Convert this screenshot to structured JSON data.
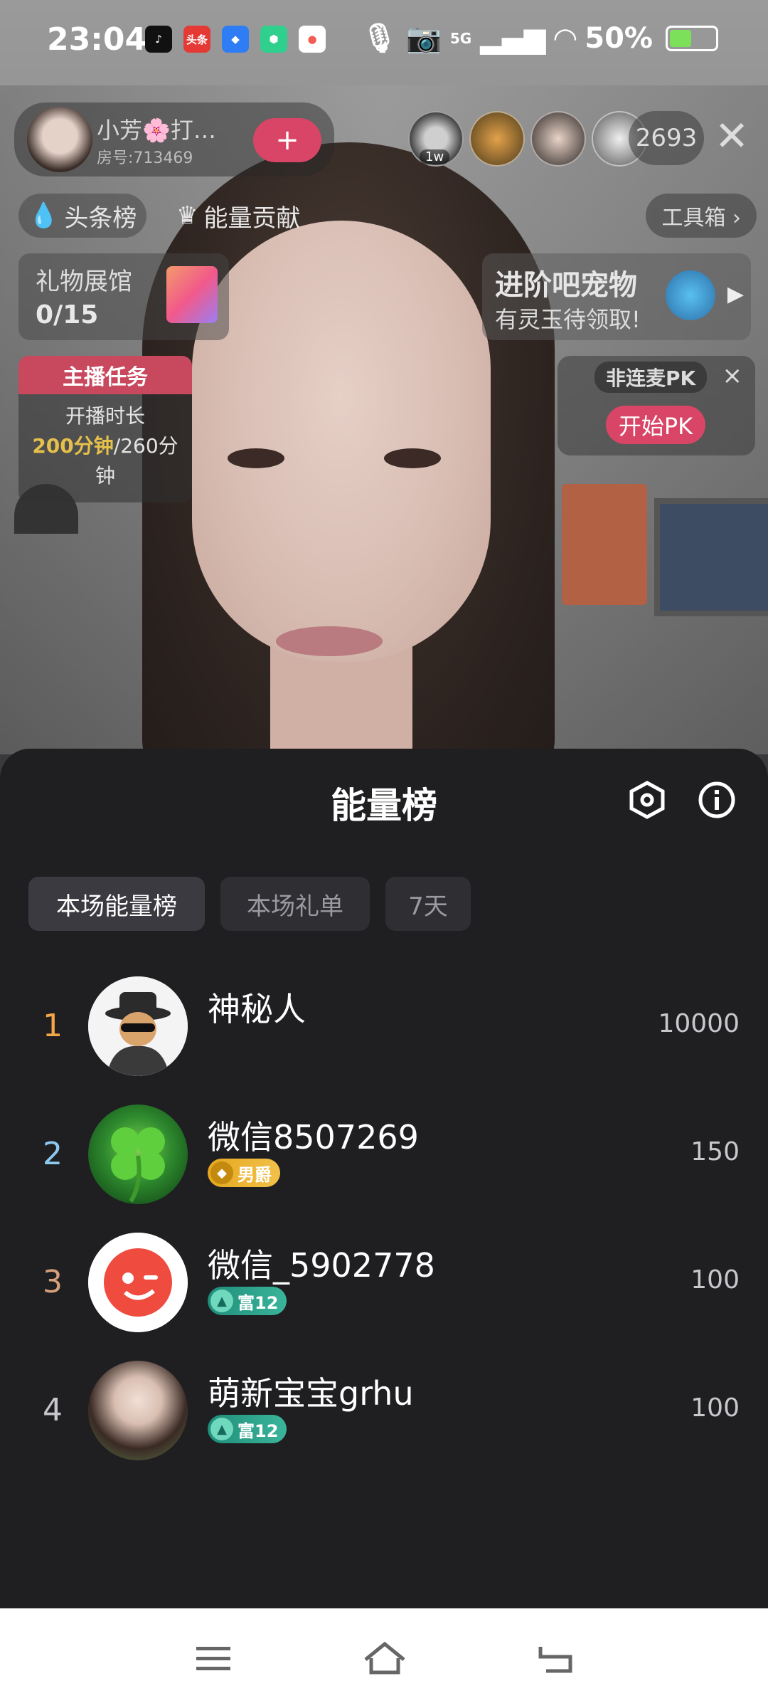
{
  "status_bar": {
    "time": "23:04",
    "app_icons": [
      {
        "icon": "douyin-icon",
        "label": "",
        "color": "#111111"
      },
      {
        "icon": "toutiao-icon",
        "label": "头条",
        "color": "#e53935"
      },
      {
        "icon": "app-icon",
        "label": "",
        "color": "#2f7df5"
      },
      {
        "icon": "cube-app-icon",
        "label": "",
        "color": "#2fcf8d"
      },
      {
        "icon": "map-app-icon",
        "label": "",
        "color": "#f25c54"
      }
    ],
    "network": "5G",
    "battery": "50%"
  },
  "host": {
    "name": "小芳🌸打…",
    "room": "房号:713469",
    "follow_label": "+"
  },
  "viewers": {
    "top_badge": "1w",
    "count": "2693",
    "close_label": "✕"
  },
  "top_tabs": {
    "headline": "头条榜",
    "energy": "能量贡献",
    "toolbox": "工具箱 ›"
  },
  "gift_hall": {
    "title": "礼物展馆",
    "count": "0/15"
  },
  "pet_banner": {
    "title": "进阶吧宠物",
    "subtitle": "有灵玉待领取!"
  },
  "host_task": {
    "header": "主播任务",
    "label": "开播时长",
    "progress_done": "200分钟",
    "progress_total": "/260分钟"
  },
  "pk": {
    "tag": "非连麦PK",
    "close": "×",
    "button": "开始PK"
  },
  "sheet": {
    "title": "能量榜",
    "tabs": [
      "本场能量榜",
      "本场礼单",
      "7天"
    ],
    "active_tab": 0,
    "entries": [
      {
        "rank": "1",
        "name": "神秘人",
        "score": "10000",
        "rank_color": "#f5a646",
        "badge": null
      },
      {
        "rank": "2",
        "name": "微信8507269",
        "score": "150",
        "rank_color": "#8ecaf0",
        "badge": {
          "text": "男爵",
          "style": "gold"
        }
      },
      {
        "rank": "3",
        "name": "微信_5902778",
        "score": "100",
        "rank_color": "#d7a07a",
        "badge": {
          "text": "富12",
          "style": "teal"
        }
      },
      {
        "rank": "4",
        "name": "萌新宝宝grhu",
        "score": "100",
        "rank_color": "#c8c8cc",
        "badge": {
          "text": "富12",
          "style": "teal"
        }
      }
    ]
  },
  "nav": {
    "icons": [
      "menu-icon",
      "home-icon",
      "back-icon"
    ]
  }
}
